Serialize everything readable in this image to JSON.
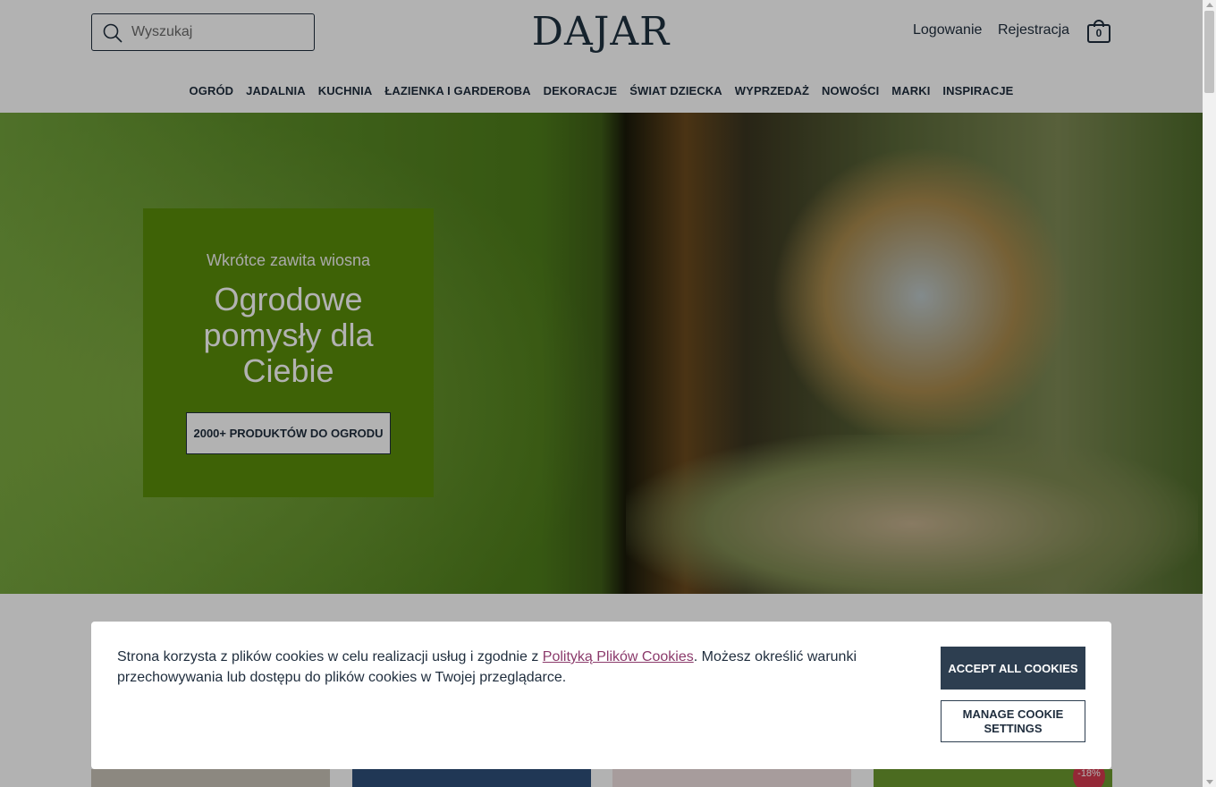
{
  "header": {
    "search_placeholder": "Wyszukaj",
    "logo": "DAJAR",
    "login": "Logowanie",
    "register": "Rejestracja",
    "cart_count": "0"
  },
  "nav": {
    "items": [
      "OGRÓD",
      "JADALNIA",
      "KUCHNIA",
      "ŁAZIENKA I GARDEROBA",
      "DEKORACJE",
      "ŚWIAT DZIECKA",
      "WYPRZEDAŻ",
      "NOWOŚCI",
      "MARKI",
      "INSPIRACJE"
    ]
  },
  "hero": {
    "subtitle": "Wkrótce zawita wiosna",
    "title": "Ogrodowe pomysły dla Ciebie",
    "button": "2000+ PRODUKTÓW DO OGRODU"
  },
  "products": {
    "discount_badge": "-18%"
  },
  "cookie": {
    "text_before": "Strona korzysta z plików cookies w celu realizacji usług i zgodnie z ",
    "link": "Polityką Plików Cookies",
    "text_after": ". Możesz określić warunki przechowywania lub dostępu do plików cookies w Twojej przeglądarce.",
    "accept": "ACCEPT ALL COOKIES",
    "manage": "MANAGE COOKIE SETTINGS"
  },
  "colors": {
    "brand_dark": "#2d3e50",
    "hero_box_green": "#5a8d0a",
    "link_color": "#8b3a6b",
    "badge_red": "#d43a4e"
  }
}
